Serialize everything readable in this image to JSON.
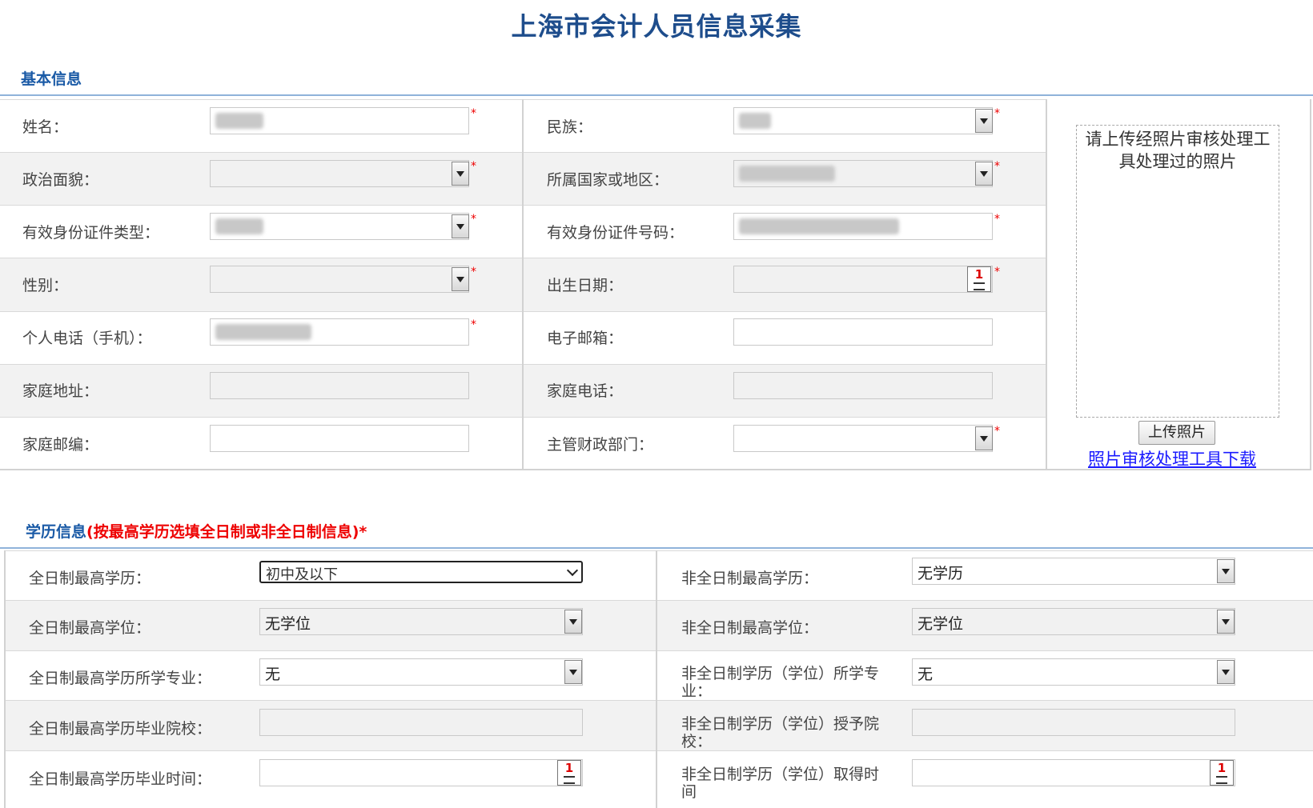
{
  "page_title": "上海市会计人员信息采集",
  "basic": {
    "section_title": "基本信息",
    "name_label": "姓名：",
    "ethnicity_label": "民族：",
    "political_label": "政治面貌：",
    "country_label": "所属国家或地区：",
    "id_type_label": "有效身份证件类型：",
    "id_number_label": "有效身份证件号码：",
    "gender_label": "性别：",
    "birth_label": "出生日期：",
    "phone_label": "个人电话（手机）：",
    "email_label": "电子邮箱：",
    "address_label": "家庭地址：",
    "home_phone_label": "家庭电话：",
    "postcode_label": "家庭邮编：",
    "finance_dept_label": "主管财政部门：",
    "required_mark": "*",
    "photo_hint": "请上传经照片审核处理工具处理过的照片",
    "upload_button": "上传照片",
    "tool_download_link": "照片审核处理工具下载"
  },
  "education": {
    "section_title": "学历信息",
    "section_note": "(按最高学历选填全日制或非全日制信息)*",
    "ft_edu_label": "全日制最高学历：",
    "ft_edu_value": "初中及以下",
    "pt_edu_label": "非全日制最高学历：",
    "pt_edu_value": "无学历",
    "ft_degree_label": "全日制最高学位：",
    "ft_degree_value": "无学位",
    "pt_degree_label": "非全日制最高学位：",
    "pt_degree_value": "无学位",
    "ft_major_label": "全日制最高学历所学专业：",
    "ft_major_value": "无",
    "pt_major_label": "非全日制学历（学位）所学专业：",
    "pt_major_value": "无",
    "ft_school_label": "全日制最高学历毕业院校：",
    "pt_school_label": "非全日制学历（学位）授予院校：",
    "ft_grad_time_label": "全日制最高学历毕业时间：",
    "pt_grad_time_label": "非全日制学历（学位）取得时间"
  },
  "icons": {
    "calendar": "calendar-icon",
    "dropdown": "dropdown-arrow-icon"
  },
  "colors": {
    "title": "#1e4d8c",
    "section": "#1a5aa6",
    "required": "#ee0000",
    "link": "#1a1aff"
  }
}
